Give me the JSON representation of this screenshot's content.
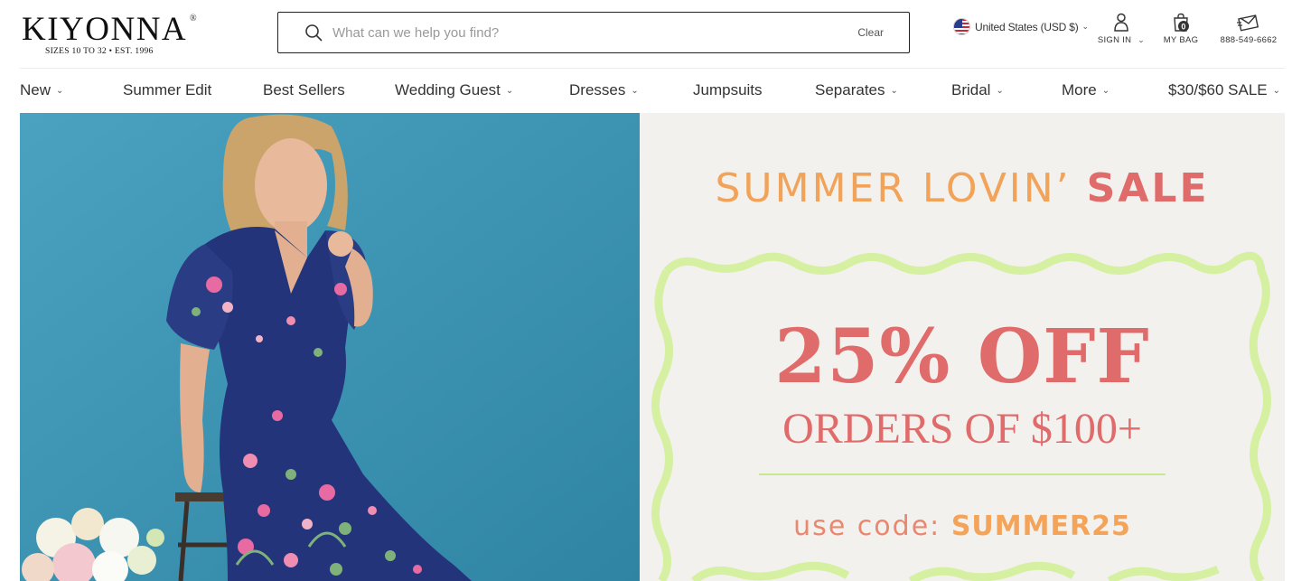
{
  "brand": {
    "name": "KIYONNA",
    "registered": "®",
    "tagline": "SIZES 10 TO 32  •  EST. 1996"
  },
  "search": {
    "placeholder": "What can we help you find?",
    "value": "",
    "clear_label": "Clear"
  },
  "locale": {
    "country_label": "United States (USD $)",
    "flag_icon": "us-flag-icon"
  },
  "utility": {
    "signin_label": "SIGN IN",
    "bag_label": "MY BAG",
    "bag_count": "0",
    "phone_label": "888-549-6662"
  },
  "nav": {
    "items": [
      {
        "label": "New",
        "dropdown": true
      },
      {
        "label": "Summer Edit",
        "dropdown": false
      },
      {
        "label": "Best Sellers",
        "dropdown": false
      },
      {
        "label": "Wedding Guest",
        "dropdown": true
      },
      {
        "label": "Dresses",
        "dropdown": true
      },
      {
        "label": "Jumpsuits",
        "dropdown": false
      },
      {
        "label": "Separates",
        "dropdown": true
      },
      {
        "label": "Bridal",
        "dropdown": true
      },
      {
        "label": "More",
        "dropdown": true
      },
      {
        "label": "$30/$60 SALE",
        "dropdown": true
      }
    ]
  },
  "hero": {
    "title_light": "SUMMER LOVIN’",
    "title_bold": "SALE",
    "headline": "25% OFF",
    "subheadline": "ORDERS OF $100+",
    "code_prefix": "use code:",
    "code": "SUMMER25"
  },
  "colors": {
    "promo_coral": "#e06b6b",
    "promo_orange": "#f3a458",
    "promo_green": "#c6e88e",
    "photo_blue": "#3f97b6",
    "dress_navy": "#23347a"
  }
}
